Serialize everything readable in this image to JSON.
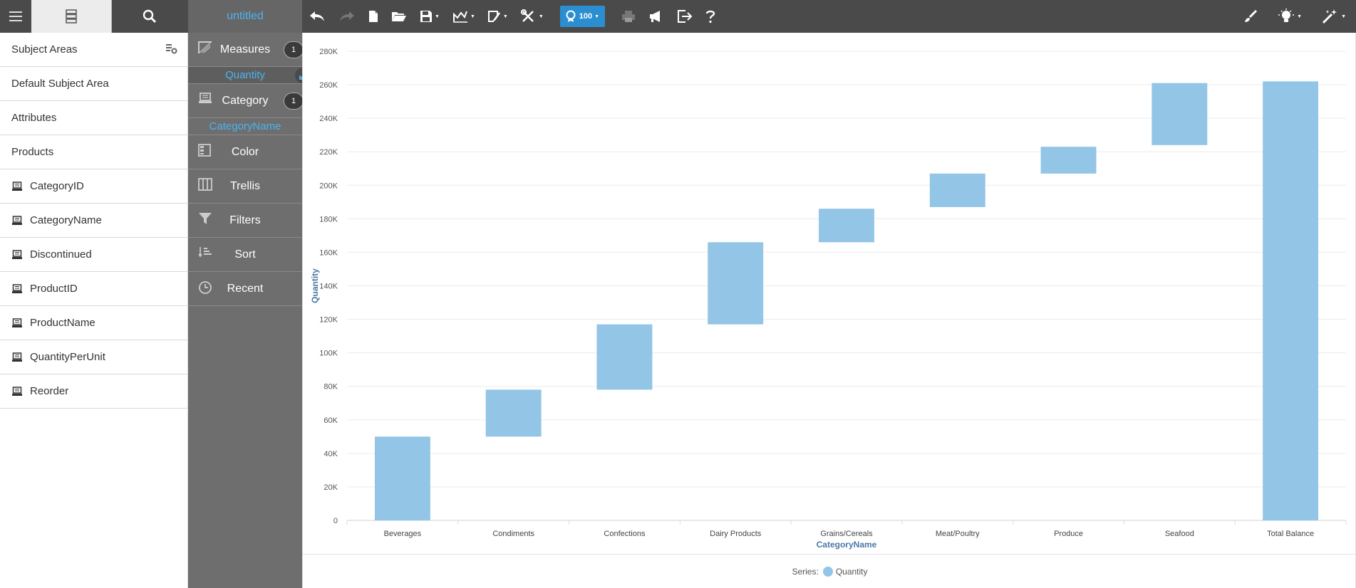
{
  "app": {
    "document_title": "untitled"
  },
  "toolbar": {
    "zoom_value": "100"
  },
  "subject_panel": {
    "header": "Subject Areas",
    "items": [
      {
        "label": "Default Subject Area",
        "type": "area"
      },
      {
        "label": "Attributes",
        "type": "area"
      },
      {
        "label": "Products",
        "type": "area"
      },
      {
        "label": "CategoryID",
        "type": "field"
      },
      {
        "label": "CategoryName",
        "type": "field"
      },
      {
        "label": "Discontinued",
        "type": "field"
      },
      {
        "label": "ProductID",
        "type": "field"
      },
      {
        "label": "ProductName",
        "type": "field"
      },
      {
        "label": "QuantityPerUnit",
        "type": "field"
      },
      {
        "label": "Reorder",
        "type": "field"
      }
    ]
  },
  "shelf": {
    "measures": {
      "label": "Measures",
      "count": "1",
      "item": "Quantity"
    },
    "category": {
      "label": "Category",
      "count": "1",
      "item": "CategoryName"
    },
    "color": "Color",
    "trellis": "Trellis",
    "filters": "Filters",
    "sort": "Sort",
    "recent": "Recent"
  },
  "chart_data": {
    "type": "bar",
    "subtype": "waterfall",
    "categories": [
      "Beverages",
      "Condiments",
      "Confections",
      "Dairy Products",
      "Grains/Cereals",
      "Meat/Poultry",
      "Produce",
      "Seafood",
      "Total Balance"
    ],
    "series": [
      {
        "name": "Quantity",
        "color": "#92c5e6",
        "values": [
          50000,
          28000,
          39000,
          49000,
          20000,
          20000,
          16000,
          37000,
          262000
        ],
        "bases": [
          0,
          50000,
          78000,
          117000,
          166000,
          187000,
          207000,
          224000,
          0
        ]
      }
    ],
    "xlabel": "CategoryName",
    "ylabel": "Quantity",
    "ylim": [
      0,
      280000
    ],
    "yticks": [
      "0",
      "20K",
      "40K",
      "60K",
      "80K",
      "100K",
      "120K",
      "140K",
      "160K",
      "180K",
      "200K",
      "220K",
      "240K",
      "260K",
      "280K"
    ],
    "grid": true,
    "legend_title": "Series:",
    "legend_position": "bottom"
  }
}
